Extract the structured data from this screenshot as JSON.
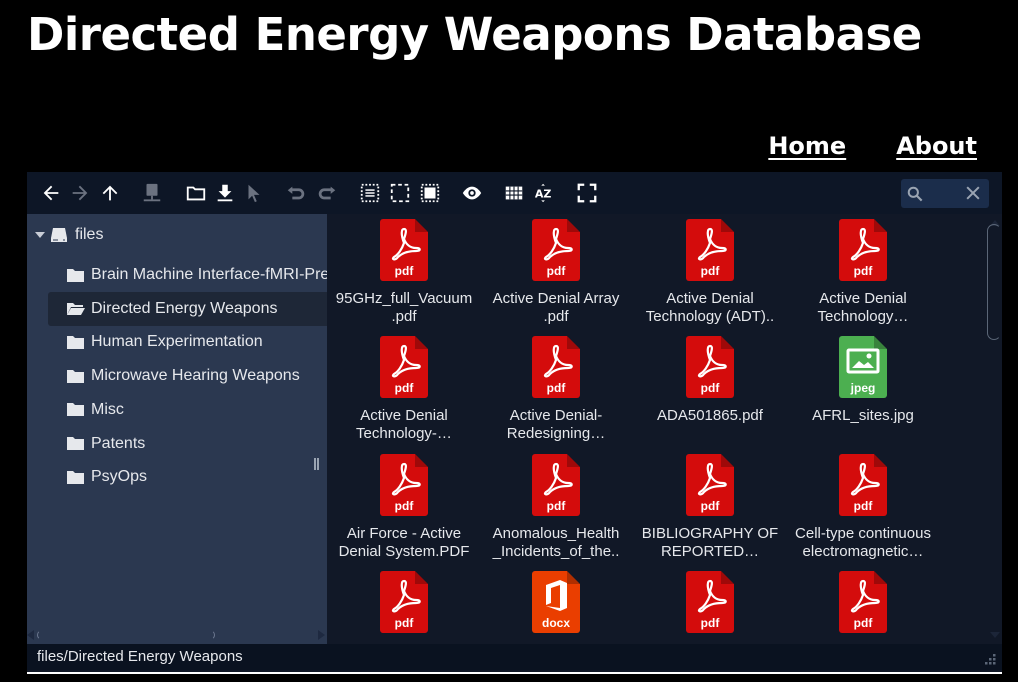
{
  "site": {
    "title": "Directed Energy Weapons Database",
    "nav": [
      {
        "label": "Home"
      },
      {
        "label": "About"
      }
    ]
  },
  "toolbar": {
    "buttons": [
      {
        "name": "back",
        "icon": "arrow-left-icon",
        "enabled": true
      },
      {
        "name": "forward",
        "icon": "arrow-right-icon",
        "enabled": false
      },
      {
        "name": "up",
        "icon": "arrow-up-icon",
        "enabled": true
      },
      {
        "name": "network-drive",
        "icon": "network-drive-icon",
        "enabled": false
      },
      {
        "name": "new-folder",
        "icon": "folder-icon",
        "enabled": true
      },
      {
        "name": "download",
        "icon": "download-icon",
        "enabled": true
      },
      {
        "name": "select",
        "icon": "cursor-icon",
        "enabled": false
      },
      {
        "name": "undo",
        "icon": "undo-icon",
        "enabled": false
      },
      {
        "name": "redo",
        "icon": "redo-icon",
        "enabled": false
      },
      {
        "name": "select-all",
        "icon": "select-all-icon",
        "enabled": true
      },
      {
        "name": "select-none",
        "icon": "select-none-icon",
        "enabled": true
      },
      {
        "name": "select-invert",
        "icon": "select-invert-icon",
        "enabled": true
      },
      {
        "name": "preview",
        "icon": "eye-icon",
        "enabled": true
      },
      {
        "name": "view-grid",
        "icon": "grid-icon",
        "enabled": true
      },
      {
        "name": "sort",
        "icon": "sort-az-icon",
        "enabled": true
      },
      {
        "name": "fullscreen",
        "icon": "fullscreen-icon",
        "enabled": true
      }
    ],
    "search": {
      "value": "",
      "placeholder": ""
    }
  },
  "tree": {
    "root": "files",
    "items": [
      {
        "label": "Brain Machine Interface-fMRI-Predictive Programming",
        "active": false
      },
      {
        "label": "Directed Energy Weapons",
        "active": true
      },
      {
        "label": "Human Experimentation",
        "active": false
      },
      {
        "label": "Microwave Hearing Weapons",
        "active": false
      },
      {
        "label": "Misc",
        "active": false
      },
      {
        "label": "Patents",
        "active": false
      },
      {
        "label": "PsyOps",
        "active": false
      }
    ]
  },
  "files": [
    {
      "name": "95GHz_full_Vacuum\n.pdf",
      "type": "pdf"
    },
    {
      "name": "Active Denial Array\n.pdf",
      "type": "pdf"
    },
    {
      "name": "Active Denial\nTechnology (ADT)..",
      "type": "pdf"
    },
    {
      "name": "Active Denial\nTechnology…",
      "type": "pdf"
    },
    {
      "name": "Active Denial\nTechnology-…",
      "type": "pdf"
    },
    {
      "name": "Active Denial-\nRedesigning…",
      "type": "pdf"
    },
    {
      "name": "ADA501865.pdf",
      "type": "pdf"
    },
    {
      "name": "AFRL_sites.jpg",
      "type": "jpeg"
    },
    {
      "name": "Air Force - Active\nDenial System.PDF",
      "type": "pdf"
    },
    {
      "name": "Anomalous_Health\n_Incidents_of_the..",
      "type": "pdf"
    },
    {
      "name": "BIBLIOGRAPHY OF\nREPORTED…",
      "type": "pdf"
    },
    {
      "name": "Cell-type continuous\nelectromagnetic…",
      "type": "pdf"
    },
    {
      "name": "",
      "type": "pdf"
    },
    {
      "name": "",
      "type": "docx"
    },
    {
      "name": "",
      "type": "pdf"
    },
    {
      "name": "",
      "type": "pdf"
    }
  ],
  "file_type_colors": {
    "pdf": "#d40c0c",
    "jpeg": "#4caf50",
    "docx": "#ea3e00"
  },
  "status": {
    "path": "files/Directed Energy Weapons"
  }
}
